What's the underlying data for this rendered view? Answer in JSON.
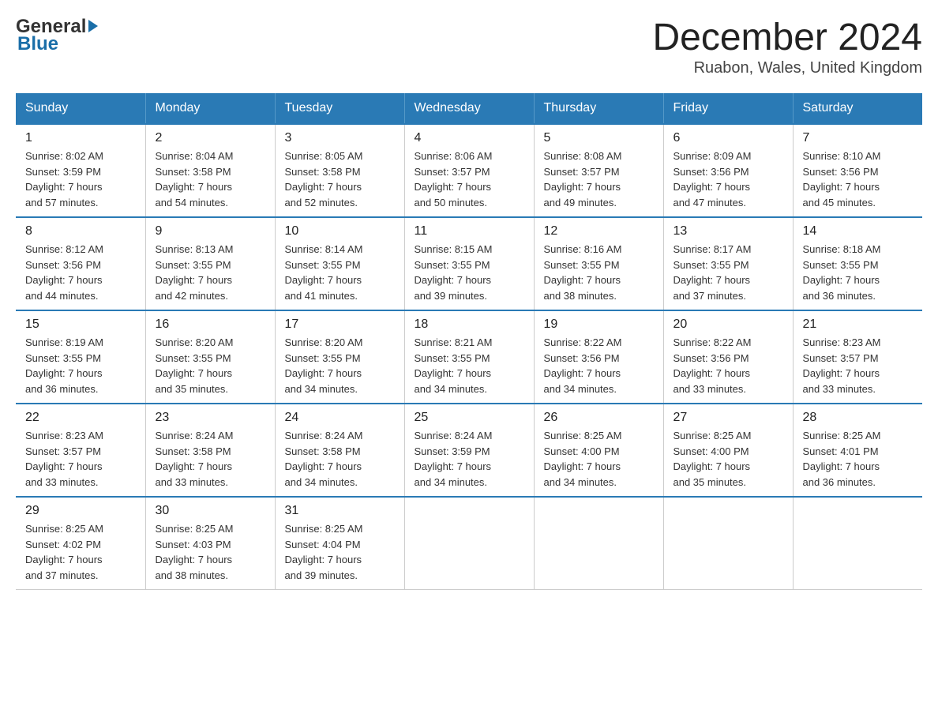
{
  "header": {
    "logo_general": "General",
    "logo_blue": "Blue",
    "title": "December 2024",
    "location": "Ruabon, Wales, United Kingdom"
  },
  "days_of_week": [
    "Sunday",
    "Monday",
    "Tuesday",
    "Wednesday",
    "Thursday",
    "Friday",
    "Saturday"
  ],
  "weeks": [
    [
      {
        "day": "1",
        "info": "Sunrise: 8:02 AM\nSunset: 3:59 PM\nDaylight: 7 hours\nand 57 minutes."
      },
      {
        "day": "2",
        "info": "Sunrise: 8:04 AM\nSunset: 3:58 PM\nDaylight: 7 hours\nand 54 minutes."
      },
      {
        "day": "3",
        "info": "Sunrise: 8:05 AM\nSunset: 3:58 PM\nDaylight: 7 hours\nand 52 minutes."
      },
      {
        "day": "4",
        "info": "Sunrise: 8:06 AM\nSunset: 3:57 PM\nDaylight: 7 hours\nand 50 minutes."
      },
      {
        "day": "5",
        "info": "Sunrise: 8:08 AM\nSunset: 3:57 PM\nDaylight: 7 hours\nand 49 minutes."
      },
      {
        "day": "6",
        "info": "Sunrise: 8:09 AM\nSunset: 3:56 PM\nDaylight: 7 hours\nand 47 minutes."
      },
      {
        "day": "7",
        "info": "Sunrise: 8:10 AM\nSunset: 3:56 PM\nDaylight: 7 hours\nand 45 minutes."
      }
    ],
    [
      {
        "day": "8",
        "info": "Sunrise: 8:12 AM\nSunset: 3:56 PM\nDaylight: 7 hours\nand 44 minutes."
      },
      {
        "day": "9",
        "info": "Sunrise: 8:13 AM\nSunset: 3:55 PM\nDaylight: 7 hours\nand 42 minutes."
      },
      {
        "day": "10",
        "info": "Sunrise: 8:14 AM\nSunset: 3:55 PM\nDaylight: 7 hours\nand 41 minutes."
      },
      {
        "day": "11",
        "info": "Sunrise: 8:15 AM\nSunset: 3:55 PM\nDaylight: 7 hours\nand 39 minutes."
      },
      {
        "day": "12",
        "info": "Sunrise: 8:16 AM\nSunset: 3:55 PM\nDaylight: 7 hours\nand 38 minutes."
      },
      {
        "day": "13",
        "info": "Sunrise: 8:17 AM\nSunset: 3:55 PM\nDaylight: 7 hours\nand 37 minutes."
      },
      {
        "day": "14",
        "info": "Sunrise: 8:18 AM\nSunset: 3:55 PM\nDaylight: 7 hours\nand 36 minutes."
      }
    ],
    [
      {
        "day": "15",
        "info": "Sunrise: 8:19 AM\nSunset: 3:55 PM\nDaylight: 7 hours\nand 36 minutes."
      },
      {
        "day": "16",
        "info": "Sunrise: 8:20 AM\nSunset: 3:55 PM\nDaylight: 7 hours\nand 35 minutes."
      },
      {
        "day": "17",
        "info": "Sunrise: 8:20 AM\nSunset: 3:55 PM\nDaylight: 7 hours\nand 34 minutes."
      },
      {
        "day": "18",
        "info": "Sunrise: 8:21 AM\nSunset: 3:55 PM\nDaylight: 7 hours\nand 34 minutes."
      },
      {
        "day": "19",
        "info": "Sunrise: 8:22 AM\nSunset: 3:56 PM\nDaylight: 7 hours\nand 34 minutes."
      },
      {
        "day": "20",
        "info": "Sunrise: 8:22 AM\nSunset: 3:56 PM\nDaylight: 7 hours\nand 33 minutes."
      },
      {
        "day": "21",
        "info": "Sunrise: 8:23 AM\nSunset: 3:57 PM\nDaylight: 7 hours\nand 33 minutes."
      }
    ],
    [
      {
        "day": "22",
        "info": "Sunrise: 8:23 AM\nSunset: 3:57 PM\nDaylight: 7 hours\nand 33 minutes."
      },
      {
        "day": "23",
        "info": "Sunrise: 8:24 AM\nSunset: 3:58 PM\nDaylight: 7 hours\nand 33 minutes."
      },
      {
        "day": "24",
        "info": "Sunrise: 8:24 AM\nSunset: 3:58 PM\nDaylight: 7 hours\nand 34 minutes."
      },
      {
        "day": "25",
        "info": "Sunrise: 8:24 AM\nSunset: 3:59 PM\nDaylight: 7 hours\nand 34 minutes."
      },
      {
        "day": "26",
        "info": "Sunrise: 8:25 AM\nSunset: 4:00 PM\nDaylight: 7 hours\nand 34 minutes."
      },
      {
        "day": "27",
        "info": "Sunrise: 8:25 AM\nSunset: 4:00 PM\nDaylight: 7 hours\nand 35 minutes."
      },
      {
        "day": "28",
        "info": "Sunrise: 8:25 AM\nSunset: 4:01 PM\nDaylight: 7 hours\nand 36 minutes."
      }
    ],
    [
      {
        "day": "29",
        "info": "Sunrise: 8:25 AM\nSunset: 4:02 PM\nDaylight: 7 hours\nand 37 minutes."
      },
      {
        "day": "30",
        "info": "Sunrise: 8:25 AM\nSunset: 4:03 PM\nDaylight: 7 hours\nand 38 minutes."
      },
      {
        "day": "31",
        "info": "Sunrise: 8:25 AM\nSunset: 4:04 PM\nDaylight: 7 hours\nand 39 minutes."
      },
      {
        "day": "",
        "info": ""
      },
      {
        "day": "",
        "info": ""
      },
      {
        "day": "",
        "info": ""
      },
      {
        "day": "",
        "info": ""
      }
    ]
  ]
}
